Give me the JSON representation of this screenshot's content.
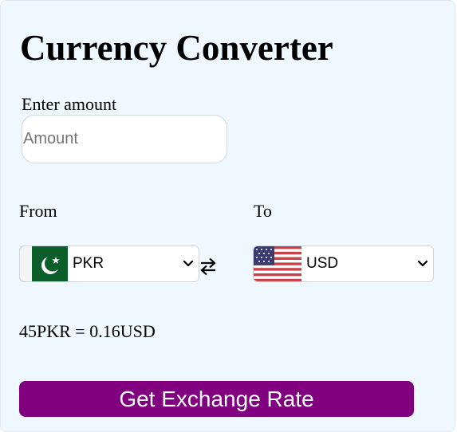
{
  "title": "Currency Converter",
  "amount": {
    "label": "Enter amount",
    "placeholder": "Amount",
    "value": ""
  },
  "from": {
    "label": "From",
    "currency": "PKR",
    "flag_icon": "pakistan-flag-icon"
  },
  "to": {
    "label": "To",
    "currency": "USD",
    "flag_icon": "usa-flag-icon"
  },
  "swap_icon": "exchange-arrows-icon",
  "result": "45PKR = 0.16USD",
  "button": {
    "label": "Get Exchange Rate"
  },
  "colors": {
    "background": "#f0f8ff",
    "button": "#800080",
    "button_text": "#ffffff"
  }
}
